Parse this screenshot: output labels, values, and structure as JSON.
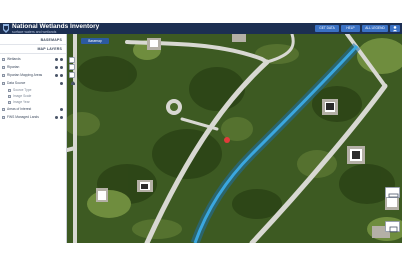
{
  "header": {
    "title": "National Wetlands Inventory",
    "subtitle": "surface waters and wetlands"
  },
  "toolbar": {
    "buttons": [
      {
        "label": "GET DATA",
        "icon": "download-icon"
      },
      {
        "label": "HELP",
        "icon": "help-icon"
      },
      {
        "label": "ALL LEGEND",
        "icon": "list-icon"
      },
      {
        "label": "",
        "icon": "user-icon"
      }
    ]
  },
  "sidebar": {
    "basemaps_title": "BASEMAPS",
    "map_layers_title": "MAP LAYERS",
    "layers": [
      {
        "label": "Wetlands",
        "sub": false
      },
      {
        "label": "Riparian",
        "sub": false
      },
      {
        "label": "Riparian Mapping Areas",
        "sub": false
      },
      {
        "label": "Data Source",
        "sub": false
      },
      {
        "label": "Source Type",
        "sub": true
      },
      {
        "label": "Image Scale",
        "sub": true
      },
      {
        "label": "Image Year",
        "sub": true
      },
      {
        "label": "Areas of Interest",
        "sub": false
      },
      {
        "label": "FWS Managed Lands",
        "sub": false
      }
    ]
  },
  "map": {
    "basemap_button": "Basemap",
    "zoom_in": "+",
    "zoom_out": "−",
    "colors": {
      "vegetation": "#3d5a22",
      "road": "#d8d8d2",
      "waterway": "#3aa7e0",
      "marker": "#e23b3b"
    }
  }
}
